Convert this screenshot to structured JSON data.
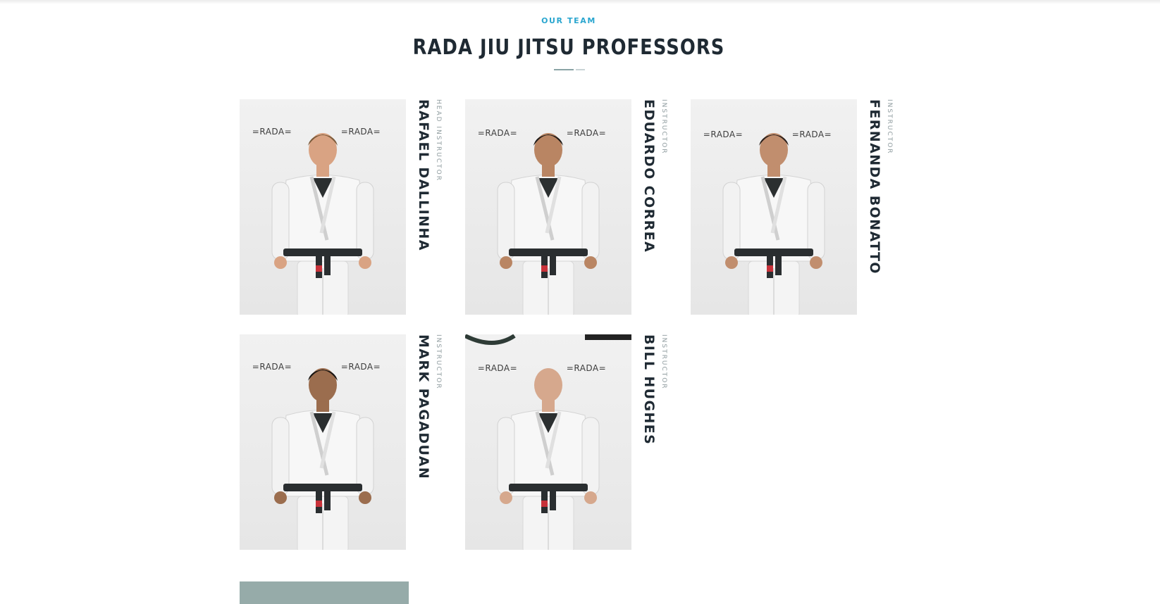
{
  "section": {
    "eyebrow": "OUR TEAM",
    "title": "RADA JIU JITSU PROFESSORS"
  },
  "professors": [
    {
      "name": "RAFAEL DALLINHA",
      "role": "HEAD INSTRUCTOR",
      "belt": "black",
      "bg_logo": "=RADA="
    },
    {
      "name": "EDUARDO CORREA",
      "role": "INSTRUCTOR",
      "belt": "black",
      "bg_logo": "=RADA="
    },
    {
      "name": "FERNANDA BONATTO",
      "role": "INSTRUCTOR",
      "belt": "black",
      "bg_logo": "=RADA="
    },
    {
      "name": "MARK PAGADUAN",
      "role": "INSTRUCTOR",
      "belt": "black",
      "bg_logo": "=RADA="
    },
    {
      "name": "BILL HUGHES",
      "role": "INSTRUCTOR",
      "belt": "black",
      "bg_logo": "=RADA="
    }
  ],
  "colors": {
    "accent": "#2aa6cf",
    "heading": "#1f2a33",
    "muted": "#8f9c9f",
    "teaser": "#96aba9"
  }
}
